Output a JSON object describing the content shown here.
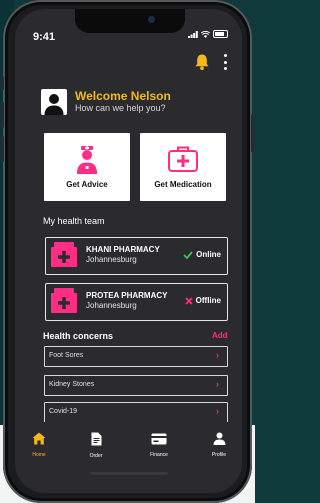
{
  "status": {
    "time": "9:41"
  },
  "welcome": {
    "title": "Welcome Nelson",
    "subtitle": "How can we help you?"
  },
  "actions": [
    {
      "label": "Get Advice",
      "icon": "doctor-icon"
    },
    {
      "label": "Get Medication",
      "icon": "first-aid-kit-icon"
    }
  ],
  "health_team": {
    "title": "My health team",
    "pharmacies": [
      {
        "name": "KHANI PHARMACY",
        "city": "Johannesburg",
        "status": "Online",
        "status_icon": "check-icon"
      },
      {
        "name": "PROTEA PHARMACY",
        "city": "Johannesburg",
        "status": "Offline",
        "status_icon": "x-icon"
      }
    ]
  },
  "concerns": {
    "title": "Health concerns",
    "add_label": "Add",
    "items": [
      "Foot Sores",
      "Kidney Stones",
      "Covid-19"
    ]
  },
  "tabs": [
    {
      "label": "Home",
      "icon": "home-icon",
      "active": true
    },
    {
      "label": "Order",
      "icon": "document-icon",
      "active": false
    },
    {
      "label": "Finance",
      "icon": "card-icon",
      "active": false
    },
    {
      "label": "Profile",
      "icon": "person-icon",
      "active": false
    }
  ],
  "colors": {
    "accent_yellow": "#F5B81C",
    "accent_pink": "#FF2D83",
    "online_green": "#34C759",
    "screen_bg": "#2B2A2E"
  }
}
